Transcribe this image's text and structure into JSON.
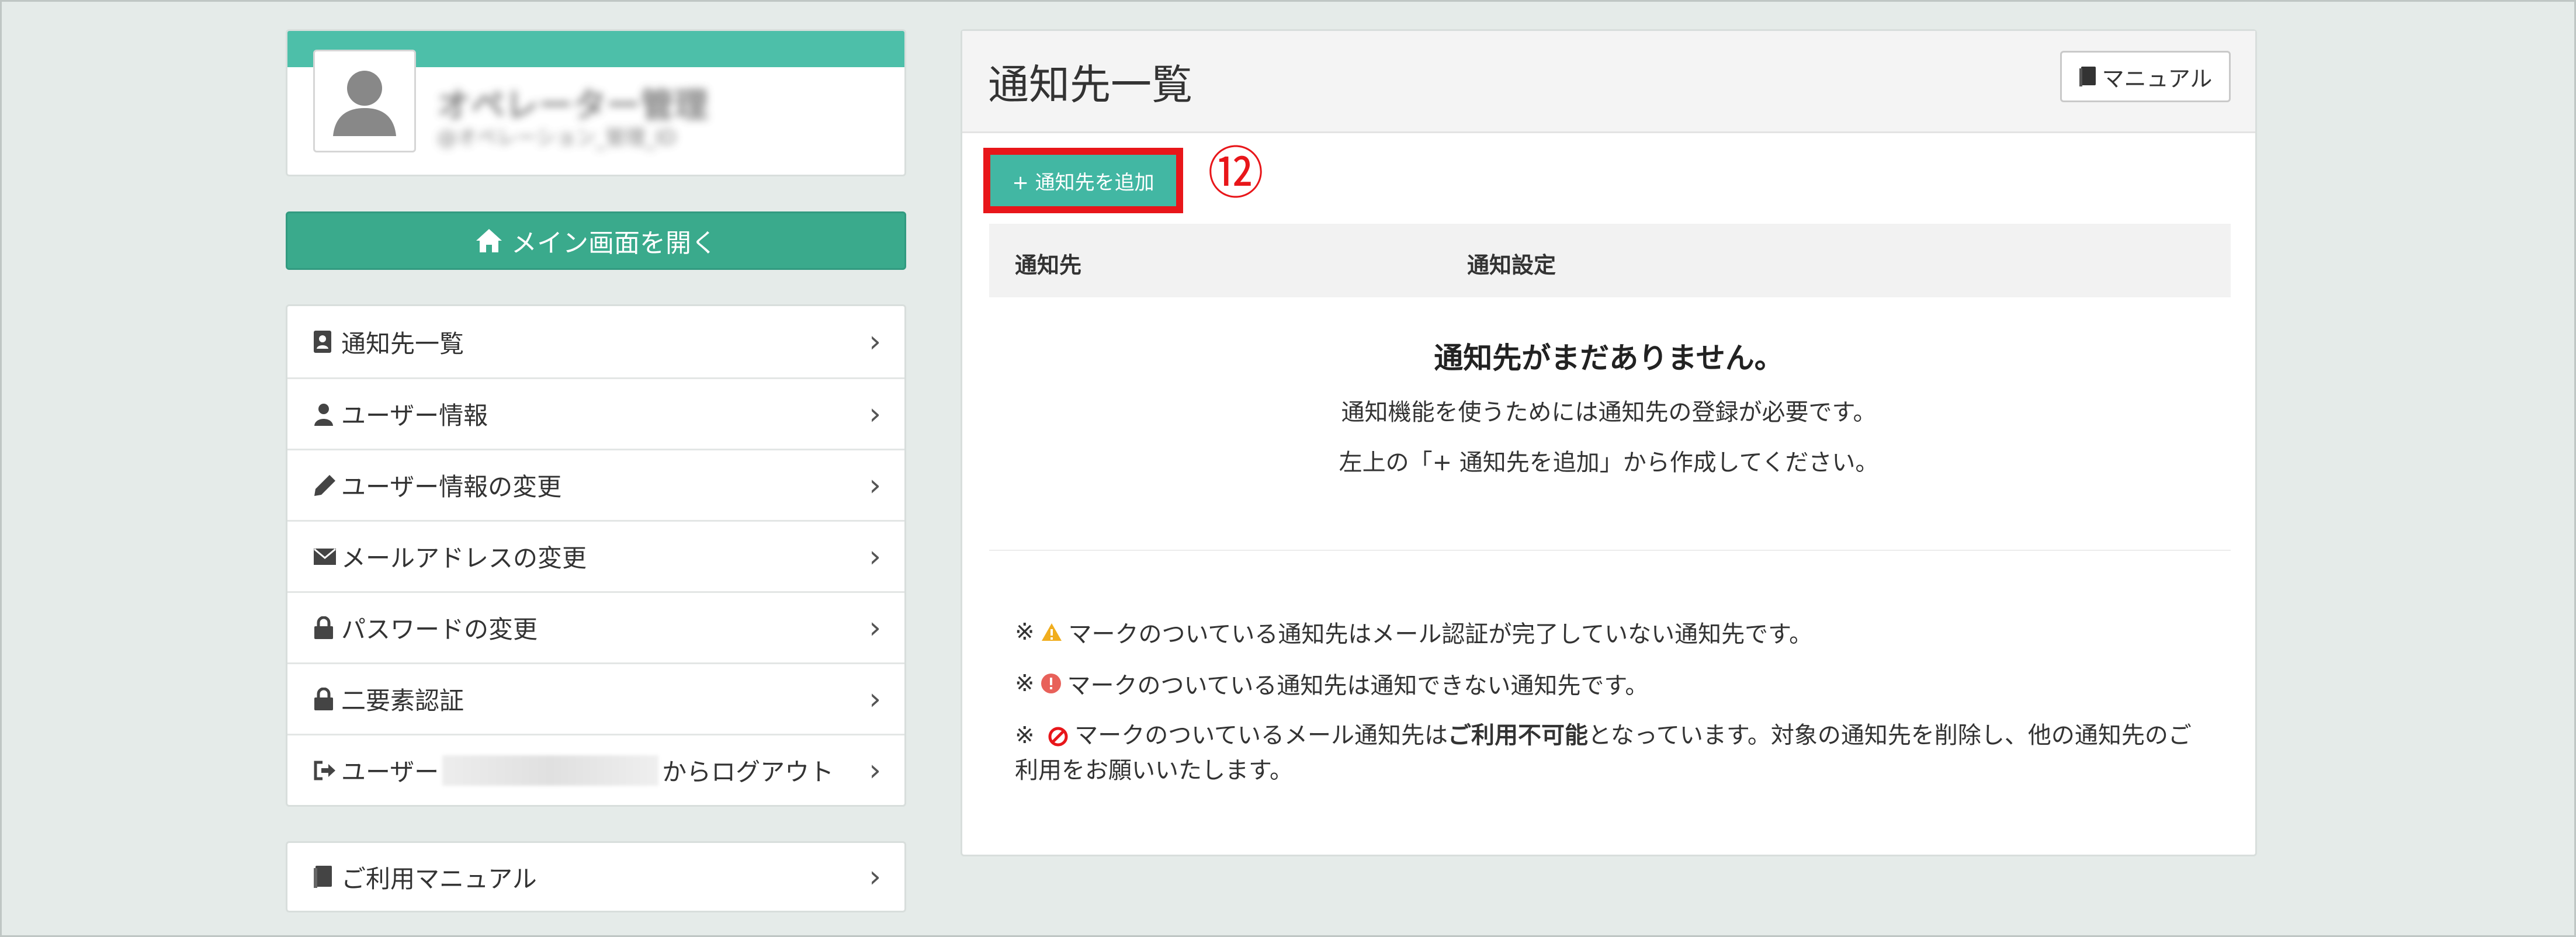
{
  "colors": {
    "accent": "#3aaa8c",
    "header_bar": "#4dbfa9",
    "highlight_red": "#e8161a",
    "background": "#e5ebe9"
  },
  "profile": {
    "name": "オペレーター管理",
    "id": "@オペレーション_管理_ID"
  },
  "sidebar": {
    "main_button": "メイン画面を開く",
    "items": [
      {
        "label": "通知先一覧",
        "icon": "contact-card-icon"
      },
      {
        "label": "ユーザー情報",
        "icon": "user-icon"
      },
      {
        "label": "ユーザー情報の変更",
        "icon": "pencil-icon"
      },
      {
        "label": "メールアドレスの変更",
        "icon": "envelope-icon"
      },
      {
        "label": "パスワードの変更",
        "icon": "lock-icon"
      },
      {
        "label": "二要素認証",
        "icon": "lock-icon"
      },
      {
        "label_prefix": "ユーザー",
        "label_suffix": "からログアウト",
        "icon": "logout-icon"
      }
    ],
    "manual": {
      "label": "ご利用マニュアル",
      "icon": "book-icon"
    }
  },
  "panel": {
    "title": "通知先一覧",
    "manual_button": "マニュアル",
    "add_button": "+ 通知先を追加",
    "callout_number": "⑫",
    "table": {
      "col1": "通知先",
      "col2": "通知設定"
    },
    "empty": {
      "title": "通知先がまだありません。",
      "line1": "通知機能を使うためには通知先の登録が必要です。",
      "line2": "左上の「+ 通知先を追加」から作成してください。"
    },
    "notes": {
      "prefix": "※",
      "note1": "マークのついている通知先はメール認証が完了していない通知先です。",
      "note2": "マークのついている通知先は通知できない通知先です。",
      "note3_a": "マークのついているメール通知先は",
      "note3_bold": "ご利用不可能",
      "note3_b": "となっています。対象の通知先を削除し、他の通知先のご利用をお願いいたします。"
    }
  }
}
